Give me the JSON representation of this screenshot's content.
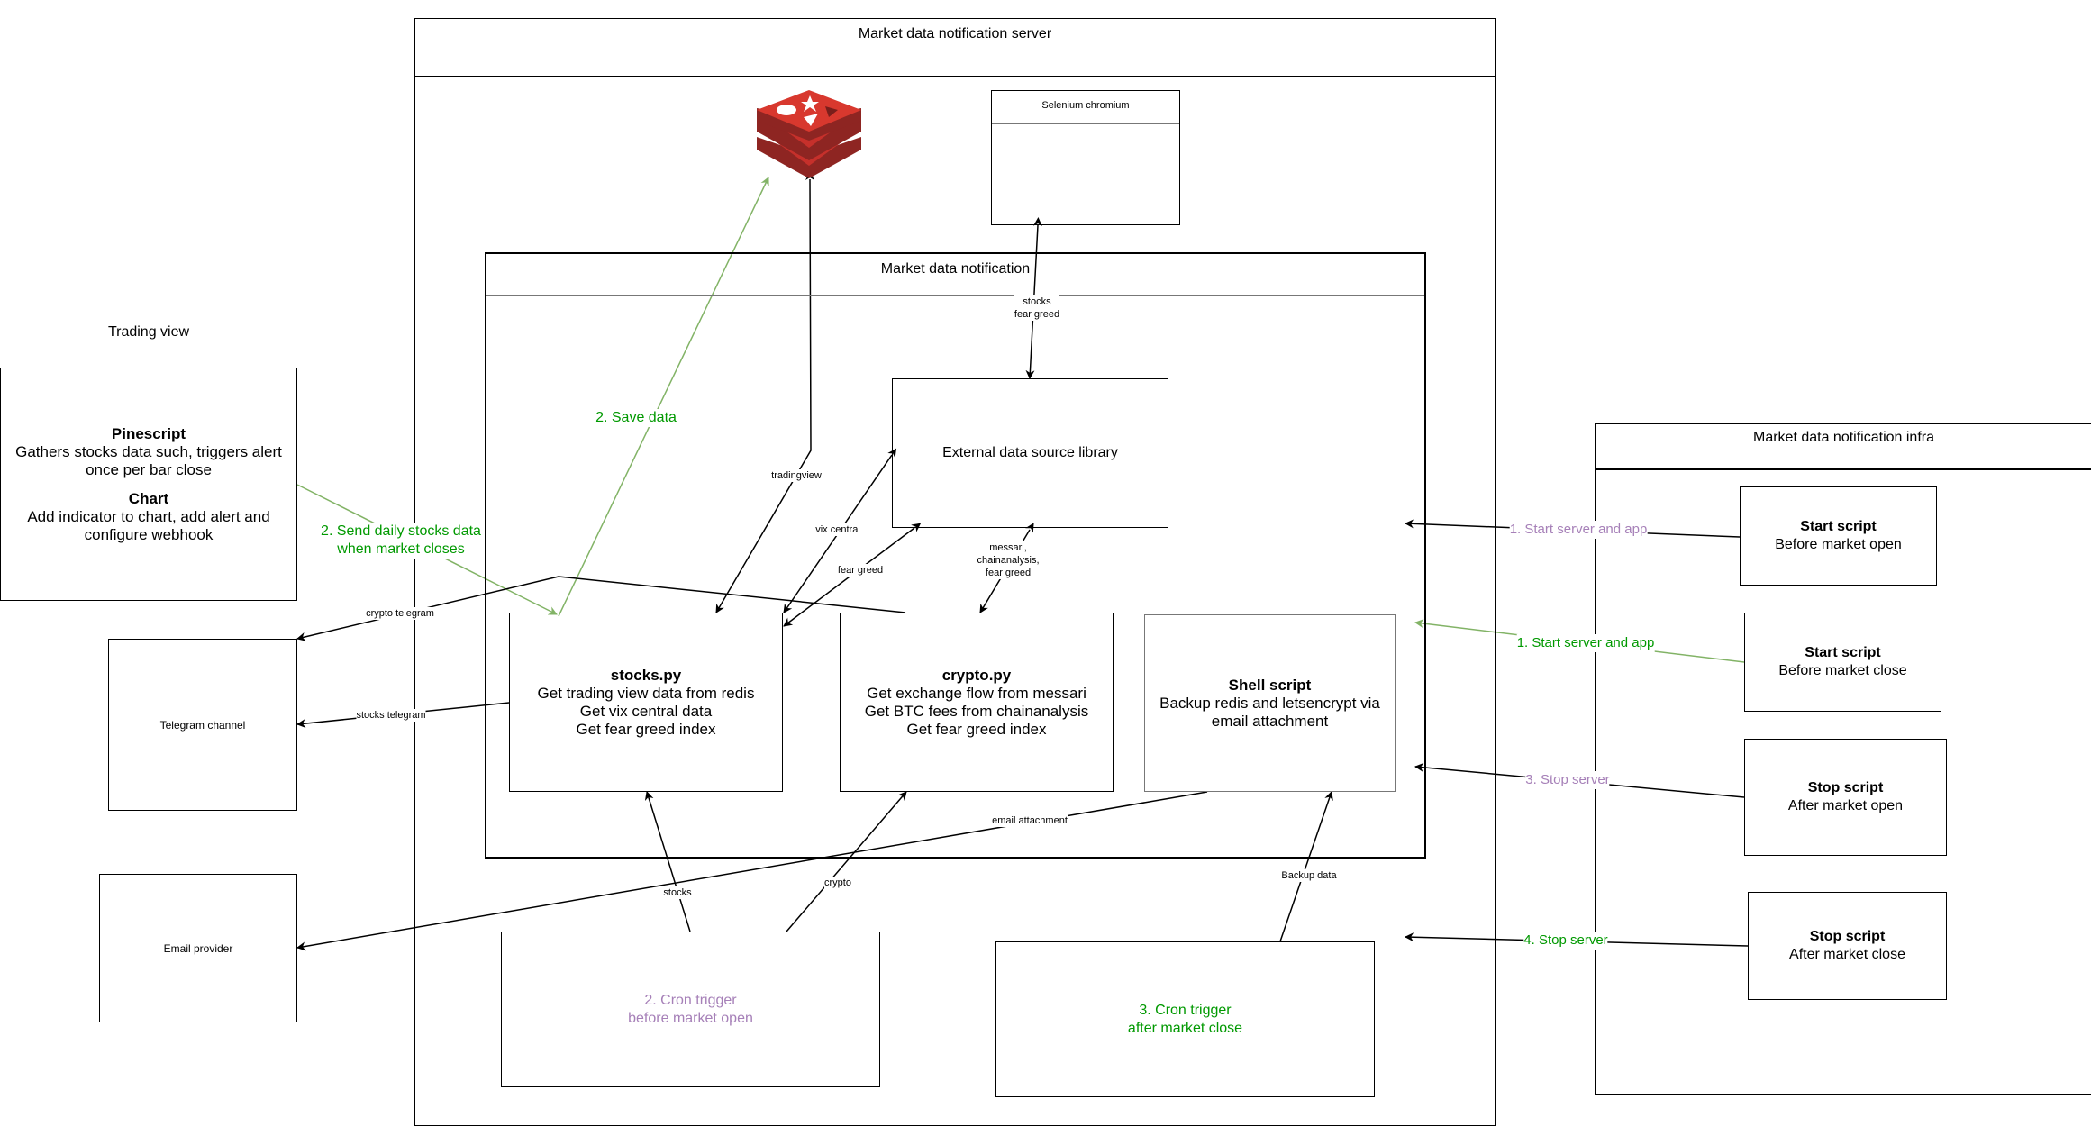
{
  "colors": {
    "purple_text": "#A680B8",
    "green_text": "#009900",
    "green_line": "#82B366",
    "redis_red": "#C6302B",
    "redis_dark": "#8E2522"
  },
  "trading_view": {
    "title": "Trading view",
    "pinescript_heading": "Pinescript",
    "pinescript_line1": "Gathers stocks data such, triggers alert",
    "pinescript_line2": "once per bar close",
    "chart_heading": "Chart",
    "chart_line1": "Add indicator to chart, add alert and",
    "chart_line2": "configure webhook"
  },
  "telegram_channel": {
    "label": "Telegram channel"
  },
  "email_provider": {
    "label": "Email provider"
  },
  "server": {
    "title": "Market data notification server",
    "redis": {
      "icon": "redis-logo-icon"
    },
    "selenium": {
      "title": "Selenium chromium"
    },
    "app": {
      "title": "Market data notification",
      "external_lib": {
        "label": "External data source library"
      },
      "stocks_py": {
        "heading": "stocks.py",
        "lines": [
          "Get trading view data from redis",
          "Get vix central data",
          "Get fear greed index"
        ]
      },
      "crypto_py": {
        "heading": "crypto.py",
        "lines": [
          "Get exchange flow from messari",
          "Get BTC fees from chainanalysis",
          "Get fear greed index"
        ]
      },
      "shell_script": {
        "heading": "Shell script",
        "lines": [
          "Backup redis and letsencrypt via",
          "email attachment"
        ]
      }
    },
    "cron_open": {
      "line1": "2. Cron trigger",
      "line2": "before market open"
    },
    "cron_close": {
      "line1": "3. Cron trigger",
      "line2": "after market close"
    }
  },
  "infra": {
    "title": "Market data notification infra",
    "scripts": [
      {
        "heading": "Start script",
        "sub": "Before market open"
      },
      {
        "heading": "Start script",
        "sub": "Before market close"
      },
      {
        "heading": "Stop script",
        "sub": "After market open"
      },
      {
        "heading": "Stop script",
        "sub": "After market close"
      }
    ]
  },
  "edge_labels": {
    "send_daily_line1": "2. Send daily stocks data",
    "send_daily_line2": "when market closes",
    "save_data": "2. Save data",
    "tradingview": "tradingview",
    "stocks_fear_greed_line1": "stocks",
    "stocks_fear_greed_line2": "fear greed",
    "vix_central": "vix central",
    "fear_greed": "fear greed",
    "messari_line1": "messari,",
    "messari_line2": "chainanalysis,",
    "messari_line3": "fear greed",
    "crypto_telegram": "crypto telegram",
    "stocks_telegram": "stocks telegram",
    "email_attachment": "email attachment",
    "stocks": "stocks",
    "crypto": "crypto",
    "backup_data": "Backup data",
    "start1": "1. Start server and app",
    "start2": "1. Start server and app",
    "stop3": "3. Stop server",
    "stop4": "4. Stop server"
  }
}
